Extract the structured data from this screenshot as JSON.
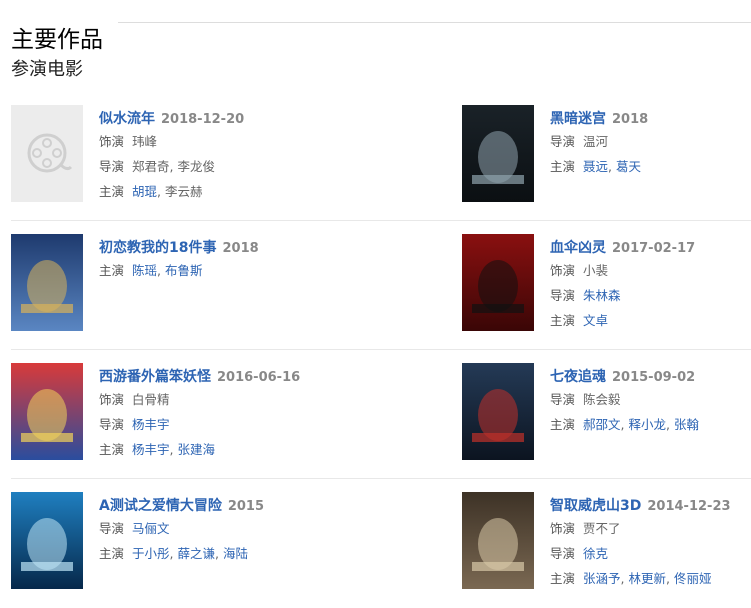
{
  "section": {
    "title": "主要作品",
    "subtitle": "参演电影"
  },
  "movies": [
    {
      "title": "似水流年",
      "date": "2018-12-20",
      "placeholder": true,
      "fields": [
        {
          "label": "饰演",
          "values": [
            {
              "text": "玮峰",
              "link": false
            }
          ]
        },
        {
          "label": "导演",
          "values": [
            {
              "text": "郑君奇",
              "link": false
            },
            {
              "text": "李龙俊",
              "link": false
            }
          ]
        },
        {
          "label": "主演",
          "values": [
            {
              "text": "胡琨",
              "link": true
            },
            {
              "text": "李云赫",
              "link": false
            }
          ]
        }
      ]
    },
    {
      "title": "黑暗迷宫",
      "date": "2018",
      "colors": [
        "#1a2228",
        "#8fa3ad",
        "#0b0f12"
      ],
      "fields": [
        {
          "label": "导演",
          "values": [
            {
              "text": "温河",
              "link": false
            }
          ]
        },
        {
          "label": "主演",
          "values": [
            {
              "text": "聂远",
              "link": true
            },
            {
              "text": "葛天",
              "link": true
            }
          ]
        }
      ]
    },
    {
      "title": "初恋教我的18件事",
      "date": "2018",
      "colors": [
        "#1e3a6e",
        "#d9b25a",
        "#5a86c2"
      ],
      "fields": [
        {
          "label": "主演",
          "values": [
            {
              "text": "陈瑶",
              "link": true
            },
            {
              "text": "布鲁斯",
              "link": true
            }
          ]
        }
      ]
    },
    {
      "title": "血伞凶灵",
      "date": "2017-02-17",
      "colors": [
        "#8a1010",
        "#111111",
        "#3a0606"
      ],
      "fields": [
        {
          "label": "饰演",
          "values": [
            {
              "text": "小裴",
              "link": false
            }
          ]
        },
        {
          "label": "导演",
          "values": [
            {
              "text": "朱林森",
              "link": true
            }
          ]
        },
        {
          "label": "主演",
          "values": [
            {
              "text": "文卓",
              "link": true
            }
          ]
        }
      ]
    },
    {
      "title": "西游番外篇笨妖怪",
      "date": "2016-06-16",
      "colors": [
        "#d83a3a",
        "#f2d35a",
        "#2a4d9e"
      ],
      "fields": [
        {
          "label": "饰演",
          "values": [
            {
              "text": "白骨精",
              "link": false
            }
          ]
        },
        {
          "label": "导演",
          "values": [
            {
              "text": "杨丰宇",
              "link": true
            }
          ]
        },
        {
          "label": "主演",
          "values": [
            {
              "text": "杨丰宇",
              "link": true
            },
            {
              "text": "张建海",
              "link": true
            }
          ]
        }
      ]
    },
    {
      "title": "七夜追魂",
      "date": "2015-09-02",
      "colors": [
        "#243a56",
        "#c0302a",
        "#0c1420"
      ],
      "fields": [
        {
          "label": "导演",
          "values": [
            {
              "text": "陈会毅",
              "link": false
            }
          ]
        },
        {
          "label": "主演",
          "values": [
            {
              "text": "郝邵文",
              "link": true
            },
            {
              "text": "释小龙",
              "link": true
            },
            {
              "text": "张翰",
              "link": true
            }
          ]
        }
      ]
    },
    {
      "title": "A测试之爱情大冒险",
      "date": "2015",
      "colors": [
        "#1f7fc0",
        "#bfe6f6",
        "#06284a"
      ],
      "fields": [
        {
          "label": "导演",
          "values": [
            {
              "text": "马俪文",
              "link": true
            }
          ]
        },
        {
          "label": "主演",
          "values": [
            {
              "text": "于小彤",
              "link": true
            },
            {
              "text": "薛之谦",
              "link": true
            },
            {
              "text": "海陆",
              "link": true
            }
          ]
        }
      ]
    },
    {
      "title": "智取威虎山3D",
      "date": "2014-12-23",
      "colors": [
        "#3d3226",
        "#d8c9a8",
        "#7a6852"
      ],
      "fields": [
        {
          "label": "饰演",
          "values": [
            {
              "text": "贾不了",
              "link": false
            }
          ]
        },
        {
          "label": "导演",
          "values": [
            {
              "text": "徐克",
              "link": true
            }
          ]
        },
        {
          "label": "主演",
          "values": [
            {
              "text": "张涵予",
              "link": true
            },
            {
              "text": "林更新",
              "link": true
            },
            {
              "text": "佟丽娅",
              "link": true
            }
          ]
        }
      ]
    }
  ]
}
